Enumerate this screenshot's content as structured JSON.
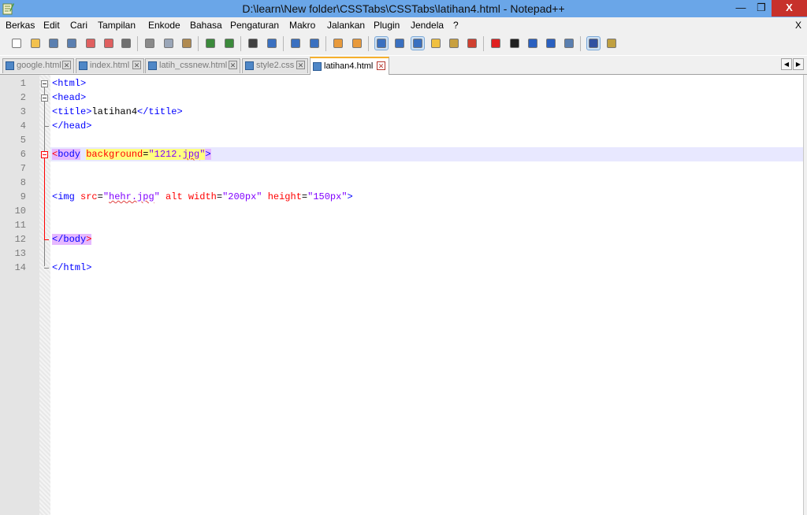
{
  "window": {
    "title": "D:\\learn\\New folder\\CSSTabs\\CSSTabs\\latihan4.html - Notepad++",
    "minimize_glyph": "—",
    "restore_glyph": "❐",
    "close_glyph": "X"
  },
  "menu": {
    "items": [
      "Berkas",
      "Edit",
      "Cari",
      "Tampilan",
      "Enkode",
      "Bahasa",
      "Pengaturan",
      "Makro",
      "Jalankan",
      "Plugin",
      "Jendela",
      "?"
    ],
    "close_label": "X"
  },
  "toolbar": {
    "buttons": [
      {
        "icon": "new-file-icon",
        "color": "#ffffff"
      },
      {
        "icon": "open-file-icon",
        "color": "#f2c14e"
      },
      {
        "icon": "save-icon",
        "color": "#5a7fb0"
      },
      {
        "icon": "save-all-icon",
        "color": "#5a7fb0"
      },
      {
        "icon": "close-file-icon",
        "color": "#e06060"
      },
      {
        "icon": "close-all-icon",
        "color": "#e06060"
      },
      {
        "icon": "print-icon",
        "color": "#707070"
      },
      {
        "icon": "cut-icon",
        "color": "#8a8a8a"
      },
      {
        "icon": "copy-icon",
        "color": "#9aa6b8"
      },
      {
        "icon": "paste-icon",
        "color": "#b08a50"
      },
      {
        "icon": "undo-icon",
        "color": "#3b8a3b"
      },
      {
        "icon": "redo-icon",
        "color": "#3b8a3b"
      },
      {
        "icon": "find-icon",
        "color": "#404040"
      },
      {
        "icon": "replace-icon",
        "color": "#3a70c0"
      },
      {
        "icon": "zoom-in-icon",
        "color": "#3a70c0"
      },
      {
        "icon": "zoom-out-icon",
        "color": "#3a70c0"
      },
      {
        "icon": "sync-vertical-icon",
        "color": "#e89a3c"
      },
      {
        "icon": "sync-horizontal-icon",
        "color": "#e89a3c"
      },
      {
        "icon": "word-wrap-icon",
        "color": "#3a70c0"
      },
      {
        "icon": "show-all-chars-icon",
        "color": "#3a70c0"
      },
      {
        "icon": "indent-guide-icon",
        "color": "#3a70c0"
      },
      {
        "icon": "user-lang-icon",
        "color": "#f0c040"
      },
      {
        "icon": "doc-map-icon",
        "color": "#c8a040"
      },
      {
        "icon": "function-list-icon",
        "color": "#d04030"
      },
      {
        "icon": "record-macro-icon",
        "color": "#e02020"
      },
      {
        "icon": "stop-macro-icon",
        "color": "#202020"
      },
      {
        "icon": "play-macro-icon",
        "color": "#2a60c0"
      },
      {
        "icon": "run-macro-multiple-icon",
        "color": "#2a60c0"
      },
      {
        "icon": "save-macro-icon",
        "color": "#5a7fb0"
      },
      {
        "icon": "spell-check-icon",
        "color": "#3050a0"
      },
      {
        "icon": "plugin-icon",
        "color": "#c0a040"
      }
    ]
  },
  "tabs": [
    {
      "label": "google.html",
      "active": false
    },
    {
      "label": "index.html",
      "active": false
    },
    {
      "label": "latih_cssnew.html",
      "active": false
    },
    {
      "label": "style2.css",
      "active": false
    },
    {
      "label": "latihan4.html",
      "active": true
    }
  ],
  "tab_scroll": {
    "left": "◀",
    "right": "▶"
  },
  "editor": {
    "line_numbers": [
      "1",
      "2",
      "3",
      "4",
      "5",
      "6",
      "7",
      "8",
      "9",
      "10",
      "11",
      "12",
      "13",
      "14"
    ],
    "line1": {
      "open": "<html>"
    },
    "line2": {
      "open": "<head>"
    },
    "line3": {
      "open": "<title>",
      "text": "latihan4",
      "close": "</title>"
    },
    "line4": {
      "close": "</head>"
    },
    "line6": {
      "bracket_open": "<",
      "tag": "body",
      "attr": "background",
      "eq": "=",
      "q1": "\"",
      "val_pre": "1212.",
      "val_sq": "jpg",
      "q2": "\"",
      "bracket_close": ">"
    },
    "line9": {
      "open": "<img ",
      "attr_src": "src",
      "eq1": "=",
      "q1": "\"",
      "val_sq": "hehr.jpg",
      "q2": "\"",
      "attr_alt": " alt ",
      "attr_width": "width",
      "eq2": "=",
      "val_width": "\"200px\"",
      "attr_height": " height",
      "eq3": "=",
      "val_height": "\"150px\"",
      "close": ">"
    },
    "line12": {
      "open": "</",
      "tag": "body",
      "bracket_close": ">"
    },
    "line14": {
      "close": "</html>"
    }
  }
}
